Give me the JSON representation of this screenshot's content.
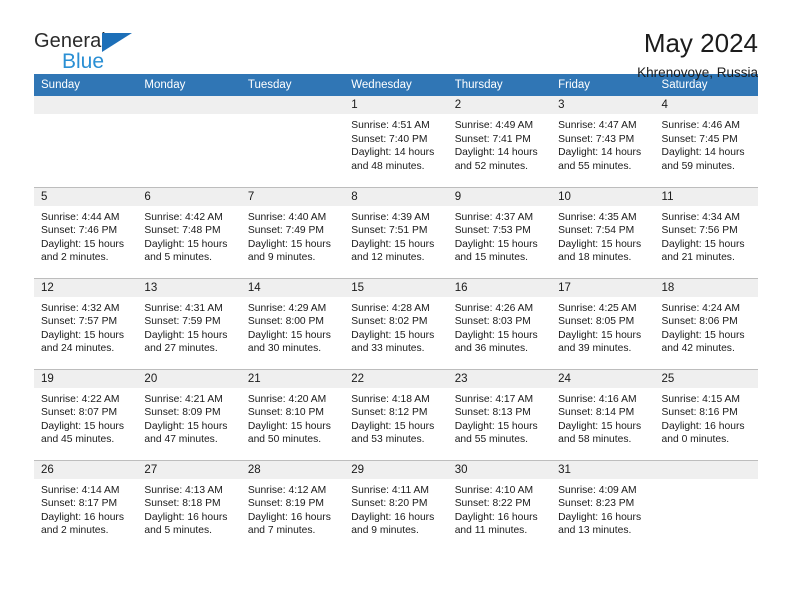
{
  "brand": {
    "word_general": "General",
    "word_blue": "Blue",
    "triangle_color": "#1d6fb8",
    "blue_text_color": "#2a8fd4"
  },
  "header": {
    "month_title": "May 2024",
    "location": "Khrenovoye, Russia"
  },
  "theme": {
    "header_bg": "#3076b5",
    "daynum_bg": "#efefef",
    "grid_line": "#bdbdbd"
  },
  "weekday_headers": [
    "Sunday",
    "Monday",
    "Tuesday",
    "Wednesday",
    "Thursday",
    "Friday",
    "Saturday"
  ],
  "weeks": [
    [
      {
        "day": "",
        "empty": true,
        "sunrise": "",
        "sunset": "",
        "daylight_line1": "",
        "daylight_line2": ""
      },
      {
        "day": "",
        "empty": true,
        "sunrise": "",
        "sunset": "",
        "daylight_line1": "",
        "daylight_line2": ""
      },
      {
        "day": "",
        "empty": true,
        "sunrise": "",
        "sunset": "",
        "daylight_line1": "",
        "daylight_line2": ""
      },
      {
        "day": "1",
        "empty": false,
        "sunrise": "Sunrise: 4:51 AM",
        "sunset": "Sunset: 7:40 PM",
        "daylight_line1": "Daylight: 14 hours",
        "daylight_line2": "and 48 minutes."
      },
      {
        "day": "2",
        "empty": false,
        "sunrise": "Sunrise: 4:49 AM",
        "sunset": "Sunset: 7:41 PM",
        "daylight_line1": "Daylight: 14 hours",
        "daylight_line2": "and 52 minutes."
      },
      {
        "day": "3",
        "empty": false,
        "sunrise": "Sunrise: 4:47 AM",
        "sunset": "Sunset: 7:43 PM",
        "daylight_line1": "Daylight: 14 hours",
        "daylight_line2": "and 55 minutes."
      },
      {
        "day": "4",
        "empty": false,
        "sunrise": "Sunrise: 4:46 AM",
        "sunset": "Sunset: 7:45 PM",
        "daylight_line1": "Daylight: 14 hours",
        "daylight_line2": "and 59 minutes."
      }
    ],
    [
      {
        "day": "5",
        "empty": false,
        "sunrise": "Sunrise: 4:44 AM",
        "sunset": "Sunset: 7:46 PM",
        "daylight_line1": "Daylight: 15 hours",
        "daylight_line2": "and 2 minutes."
      },
      {
        "day": "6",
        "empty": false,
        "sunrise": "Sunrise: 4:42 AM",
        "sunset": "Sunset: 7:48 PM",
        "daylight_line1": "Daylight: 15 hours",
        "daylight_line2": "and 5 minutes."
      },
      {
        "day": "7",
        "empty": false,
        "sunrise": "Sunrise: 4:40 AM",
        "sunset": "Sunset: 7:49 PM",
        "daylight_line1": "Daylight: 15 hours",
        "daylight_line2": "and 9 minutes."
      },
      {
        "day": "8",
        "empty": false,
        "sunrise": "Sunrise: 4:39 AM",
        "sunset": "Sunset: 7:51 PM",
        "daylight_line1": "Daylight: 15 hours",
        "daylight_line2": "and 12 minutes."
      },
      {
        "day": "9",
        "empty": false,
        "sunrise": "Sunrise: 4:37 AM",
        "sunset": "Sunset: 7:53 PM",
        "daylight_line1": "Daylight: 15 hours",
        "daylight_line2": "and 15 minutes."
      },
      {
        "day": "10",
        "empty": false,
        "sunrise": "Sunrise: 4:35 AM",
        "sunset": "Sunset: 7:54 PM",
        "daylight_line1": "Daylight: 15 hours",
        "daylight_line2": "and 18 minutes."
      },
      {
        "day": "11",
        "empty": false,
        "sunrise": "Sunrise: 4:34 AM",
        "sunset": "Sunset: 7:56 PM",
        "daylight_line1": "Daylight: 15 hours",
        "daylight_line2": "and 21 minutes."
      }
    ],
    [
      {
        "day": "12",
        "empty": false,
        "sunrise": "Sunrise: 4:32 AM",
        "sunset": "Sunset: 7:57 PM",
        "daylight_line1": "Daylight: 15 hours",
        "daylight_line2": "and 24 minutes."
      },
      {
        "day": "13",
        "empty": false,
        "sunrise": "Sunrise: 4:31 AM",
        "sunset": "Sunset: 7:59 PM",
        "daylight_line1": "Daylight: 15 hours",
        "daylight_line2": "and 27 minutes."
      },
      {
        "day": "14",
        "empty": false,
        "sunrise": "Sunrise: 4:29 AM",
        "sunset": "Sunset: 8:00 PM",
        "daylight_line1": "Daylight: 15 hours",
        "daylight_line2": "and 30 minutes."
      },
      {
        "day": "15",
        "empty": false,
        "sunrise": "Sunrise: 4:28 AM",
        "sunset": "Sunset: 8:02 PM",
        "daylight_line1": "Daylight: 15 hours",
        "daylight_line2": "and 33 minutes."
      },
      {
        "day": "16",
        "empty": false,
        "sunrise": "Sunrise: 4:26 AM",
        "sunset": "Sunset: 8:03 PM",
        "daylight_line1": "Daylight: 15 hours",
        "daylight_line2": "and 36 minutes."
      },
      {
        "day": "17",
        "empty": false,
        "sunrise": "Sunrise: 4:25 AM",
        "sunset": "Sunset: 8:05 PM",
        "daylight_line1": "Daylight: 15 hours",
        "daylight_line2": "and 39 minutes."
      },
      {
        "day": "18",
        "empty": false,
        "sunrise": "Sunrise: 4:24 AM",
        "sunset": "Sunset: 8:06 PM",
        "daylight_line1": "Daylight: 15 hours",
        "daylight_line2": "and 42 minutes."
      }
    ],
    [
      {
        "day": "19",
        "empty": false,
        "sunrise": "Sunrise: 4:22 AM",
        "sunset": "Sunset: 8:07 PM",
        "daylight_line1": "Daylight: 15 hours",
        "daylight_line2": "and 45 minutes."
      },
      {
        "day": "20",
        "empty": false,
        "sunrise": "Sunrise: 4:21 AM",
        "sunset": "Sunset: 8:09 PM",
        "daylight_line1": "Daylight: 15 hours",
        "daylight_line2": "and 47 minutes."
      },
      {
        "day": "21",
        "empty": false,
        "sunrise": "Sunrise: 4:20 AM",
        "sunset": "Sunset: 8:10 PM",
        "daylight_line1": "Daylight: 15 hours",
        "daylight_line2": "and 50 minutes."
      },
      {
        "day": "22",
        "empty": false,
        "sunrise": "Sunrise: 4:18 AM",
        "sunset": "Sunset: 8:12 PM",
        "daylight_line1": "Daylight: 15 hours",
        "daylight_line2": "and 53 minutes."
      },
      {
        "day": "23",
        "empty": false,
        "sunrise": "Sunrise: 4:17 AM",
        "sunset": "Sunset: 8:13 PM",
        "daylight_line1": "Daylight: 15 hours",
        "daylight_line2": "and 55 minutes."
      },
      {
        "day": "24",
        "empty": false,
        "sunrise": "Sunrise: 4:16 AM",
        "sunset": "Sunset: 8:14 PM",
        "daylight_line1": "Daylight: 15 hours",
        "daylight_line2": "and 58 minutes."
      },
      {
        "day": "25",
        "empty": false,
        "sunrise": "Sunrise: 4:15 AM",
        "sunset": "Sunset: 8:16 PM",
        "daylight_line1": "Daylight: 16 hours",
        "daylight_line2": "and 0 minutes."
      }
    ],
    [
      {
        "day": "26",
        "empty": false,
        "sunrise": "Sunrise: 4:14 AM",
        "sunset": "Sunset: 8:17 PM",
        "daylight_line1": "Daylight: 16 hours",
        "daylight_line2": "and 2 minutes."
      },
      {
        "day": "27",
        "empty": false,
        "sunrise": "Sunrise: 4:13 AM",
        "sunset": "Sunset: 8:18 PM",
        "daylight_line1": "Daylight: 16 hours",
        "daylight_line2": "and 5 minutes."
      },
      {
        "day": "28",
        "empty": false,
        "sunrise": "Sunrise: 4:12 AM",
        "sunset": "Sunset: 8:19 PM",
        "daylight_line1": "Daylight: 16 hours",
        "daylight_line2": "and 7 minutes."
      },
      {
        "day": "29",
        "empty": false,
        "sunrise": "Sunrise: 4:11 AM",
        "sunset": "Sunset: 8:20 PM",
        "daylight_line1": "Daylight: 16 hours",
        "daylight_line2": "and 9 minutes."
      },
      {
        "day": "30",
        "empty": false,
        "sunrise": "Sunrise: 4:10 AM",
        "sunset": "Sunset: 8:22 PM",
        "daylight_line1": "Daylight: 16 hours",
        "daylight_line2": "and 11 minutes."
      },
      {
        "day": "31",
        "empty": false,
        "sunrise": "Sunrise: 4:09 AM",
        "sunset": "Sunset: 8:23 PM",
        "daylight_line1": "Daylight: 16 hours",
        "daylight_line2": "and 13 minutes."
      },
      {
        "day": "",
        "empty": true,
        "sunrise": "",
        "sunset": "",
        "daylight_line1": "",
        "daylight_line2": ""
      }
    ]
  ]
}
